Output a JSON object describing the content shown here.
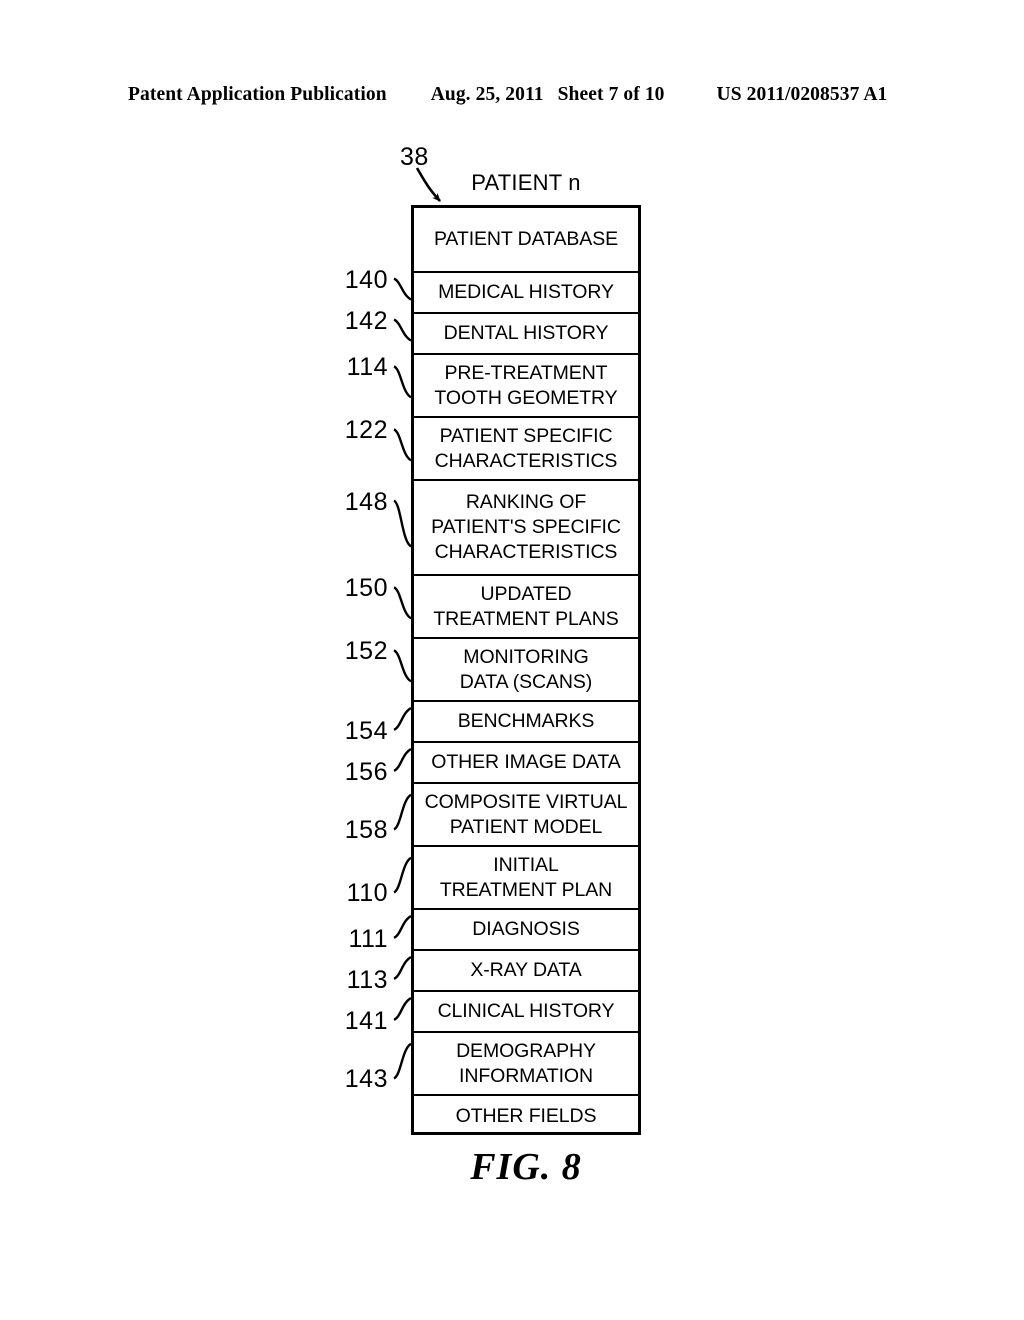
{
  "header": {
    "publication": "Patent Application Publication",
    "date": "Aug. 25, 2011",
    "sheet": "Sheet 7 of 10",
    "patent_number": "US 2011/0208537 A1"
  },
  "figure": {
    "caption": "FIG. 8",
    "diagram_title": "PATIENT n",
    "box_callout": "38",
    "header_row": "PATIENT DATABASE",
    "rows": [
      {
        "ref": "140",
        "lines": [
          "MEDICAL HISTORY"
        ]
      },
      {
        "ref": "142",
        "lines": [
          "DENTAL HISTORY"
        ]
      },
      {
        "ref": "114",
        "lines": [
          "PRE-TREATMENT",
          "TOOTH GEOMETRY"
        ]
      },
      {
        "ref": "122",
        "lines": [
          "PATIENT SPECIFIC",
          "CHARACTERISTICS"
        ]
      },
      {
        "ref": "148",
        "lines": [
          "RANKING OF",
          "PATIENT'S SPECIFIC",
          "CHARACTERISTICS"
        ]
      },
      {
        "ref": "150",
        "lines": [
          "UPDATED",
          "TREATMENT PLANS"
        ]
      },
      {
        "ref": "152",
        "lines": [
          "MONITORING",
          "DATA (SCANS)"
        ]
      },
      {
        "ref": "154",
        "lines": [
          "BENCHMARKS"
        ]
      },
      {
        "ref": "156",
        "lines": [
          "OTHER IMAGE DATA"
        ]
      },
      {
        "ref": "158",
        "lines": [
          "COMPOSITE VIRTUAL",
          "PATIENT MODEL"
        ]
      },
      {
        "ref": "110",
        "lines": [
          "INITIAL",
          "TREATMENT PLAN"
        ]
      },
      {
        "ref": "111",
        "lines": [
          "DIAGNOSIS"
        ]
      },
      {
        "ref": "113",
        "lines": [
          "X-RAY DATA"
        ]
      },
      {
        "ref": "141",
        "lines": [
          "CLINICAL HISTORY"
        ]
      },
      {
        "ref": "143",
        "lines": [
          "DEMOGRAPHY",
          "INFORMATION"
        ]
      },
      {
        "ref": "",
        "lines": [
          "OTHER FIELDS"
        ]
      }
    ]
  },
  "colors": {
    "ink": "#000000",
    "paper": "#ffffff"
  }
}
